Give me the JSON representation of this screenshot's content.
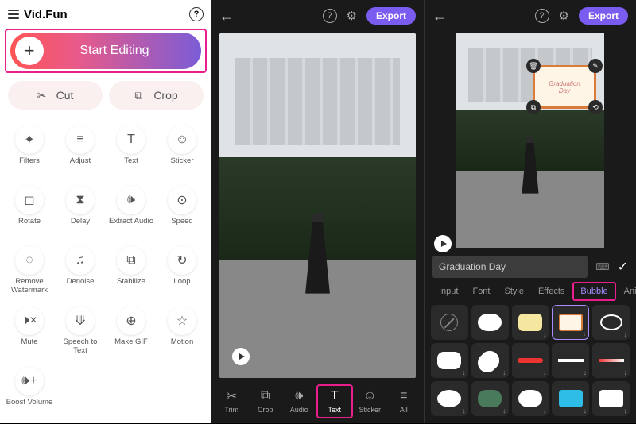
{
  "panel1": {
    "app_name": "Vid.Fun",
    "start_button": "Start Editing",
    "tabs": {
      "cut": "Cut",
      "crop": "Crop"
    },
    "tools": [
      {
        "icon": "✦",
        "label": "Filters"
      },
      {
        "icon": "≡",
        "label": "Adjust"
      },
      {
        "icon": "T",
        "label": "Text"
      },
      {
        "icon": "☺",
        "label": "Sticker"
      },
      {
        "icon": "◻",
        "label": "Rotate"
      },
      {
        "icon": "⧗",
        "label": "Delay"
      },
      {
        "icon": "🕪",
        "label": "Extract Audio"
      },
      {
        "icon": "⊙",
        "label": "Speed"
      },
      {
        "icon": "◌",
        "label": "Remove Watermark"
      },
      {
        "icon": "♫",
        "label": "Denoise"
      },
      {
        "icon": "⧉",
        "label": "Stabilize"
      },
      {
        "icon": "↻",
        "label": "Loop"
      },
      {
        "icon": "🕨×",
        "label": "Mute"
      },
      {
        "icon": "⟱",
        "label": "Speech to Text"
      },
      {
        "icon": "⊕",
        "label": "Make GIF"
      },
      {
        "icon": "☆",
        "label": "Motion"
      },
      {
        "icon": "🕪+",
        "label": "Boost Volume"
      }
    ]
  },
  "panel2": {
    "export": "Export",
    "bottom_tools": [
      {
        "icon": "✂",
        "label": "Trim"
      },
      {
        "icon": "⧉",
        "label": "Crop"
      },
      {
        "icon": "🕪",
        "label": "Audio"
      },
      {
        "icon": "T",
        "label": "Text"
      },
      {
        "icon": "☺",
        "label": "Sticker"
      },
      {
        "icon": "≡",
        "label": "All"
      }
    ],
    "active_tool_index": 3
  },
  "panel3": {
    "export": "Export",
    "overlay_text_1": "Graduation",
    "overlay_text_2": "Day",
    "text_input_value": "Graduation Day",
    "tabs": [
      "Input",
      "Font",
      "Style",
      "Effects",
      "Bubble",
      "Animation"
    ],
    "active_tab_index": 4
  }
}
